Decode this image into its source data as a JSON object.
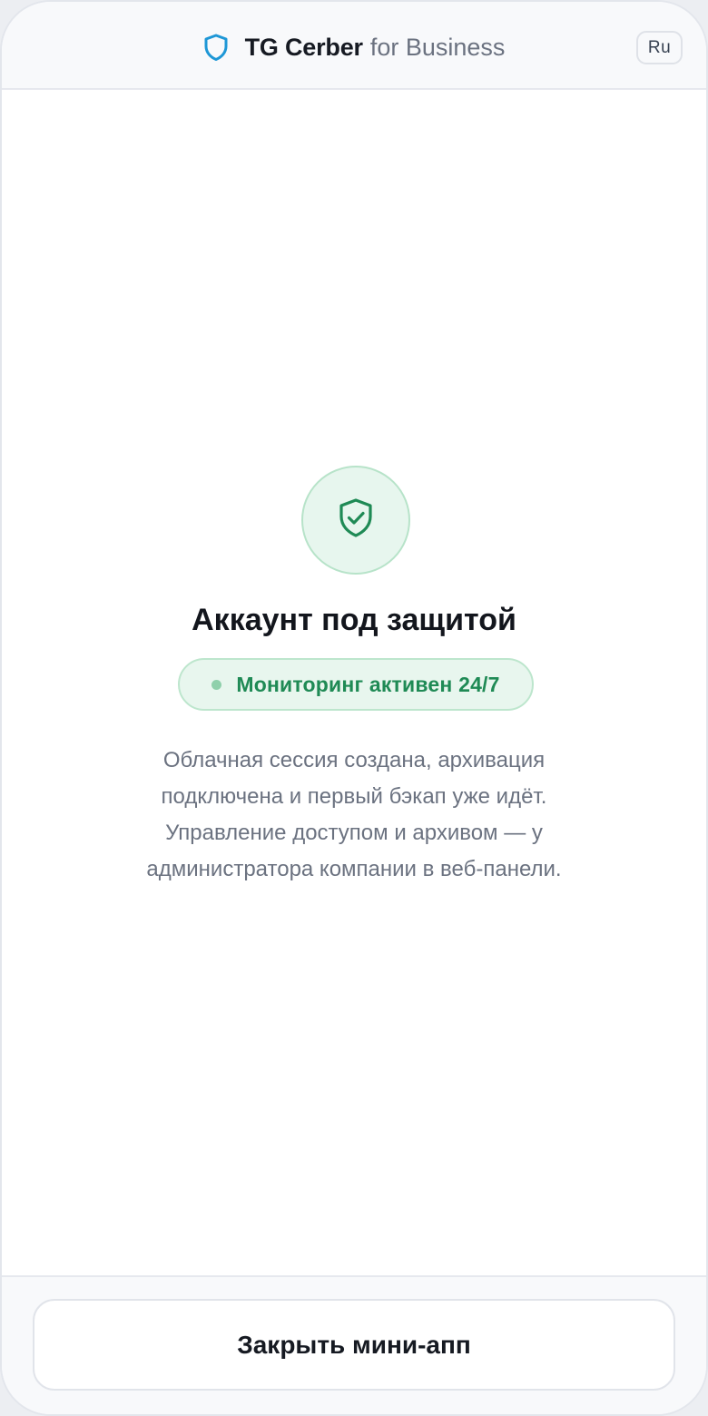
{
  "header": {
    "brand_name": "TG Cerber",
    "brand_suffix": "for Business",
    "brand_icon": "shield-icon",
    "language_label": "Ru"
  },
  "status": {
    "icon": "shield-check-icon",
    "title": "Аккаунт под защитой",
    "badge": "Мониторинг активен 24/7",
    "description": "Облачная сессия создана, архивация подключена и первый бэкап уже идёт. Управление доступом и архивом — у администратора компании в веб-панели."
  },
  "footer": {
    "close_label": "Закрыть мини-апп"
  },
  "colors": {
    "accent_blue": "#1e97d6",
    "success_green": "#1f8a55",
    "success_bg": "#e7f6ee"
  }
}
